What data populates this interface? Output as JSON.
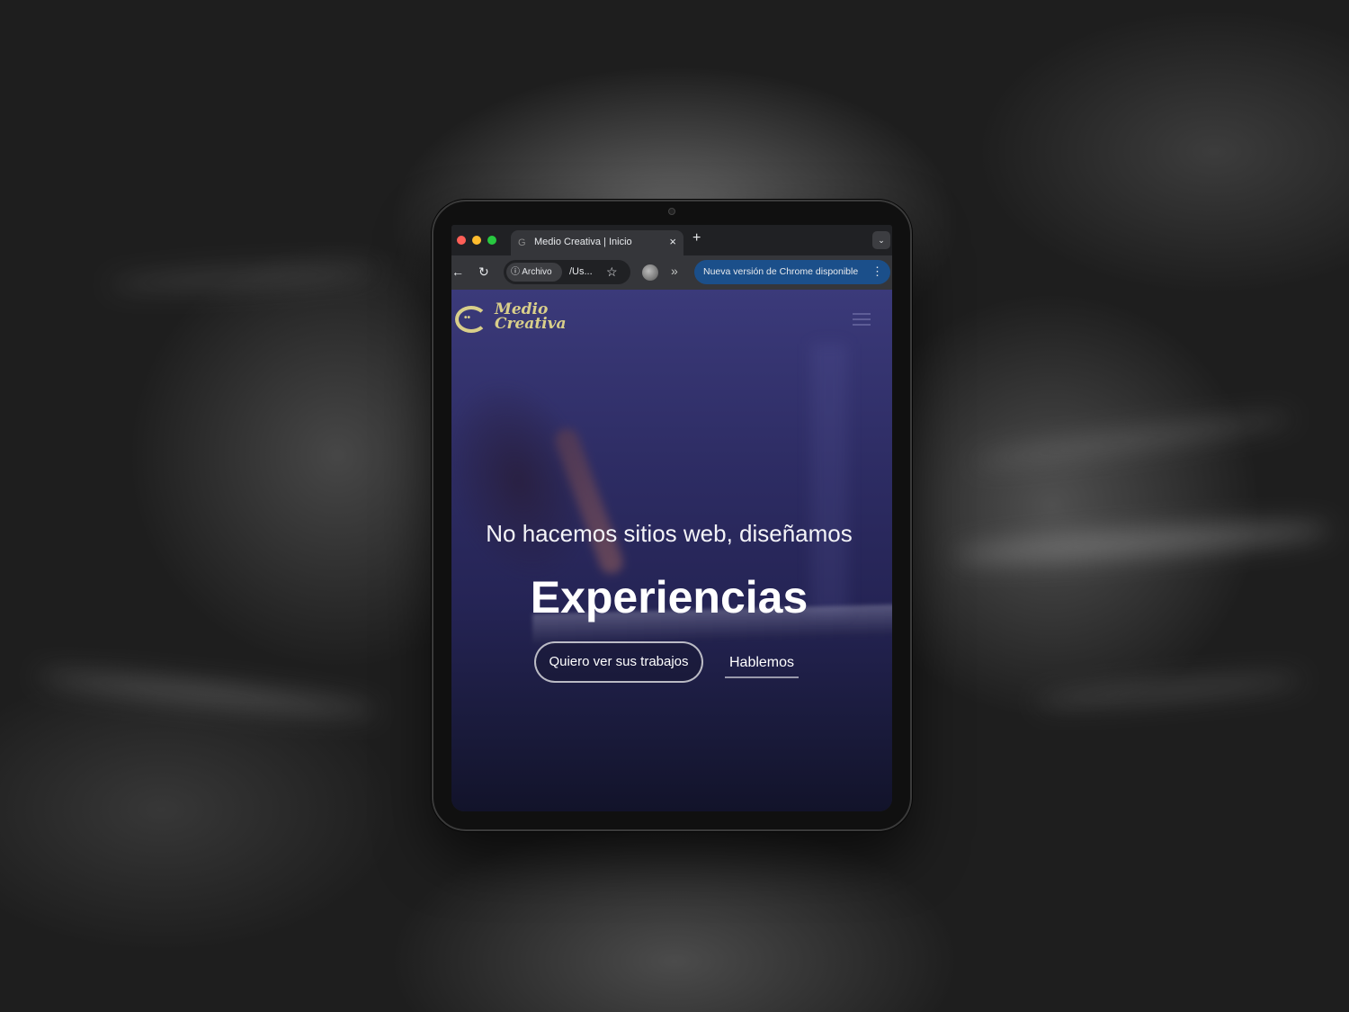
{
  "browser": {
    "tab": {
      "title": "Medio Creativa | Inicio",
      "close": "×"
    },
    "new_tab": "+",
    "tab_menu": "⌄",
    "toolbar": {
      "back": "←",
      "reload": "↻",
      "site_chip": "ⓘ Archivo",
      "url": "/Us...",
      "star": "☆",
      "more_extensions": "»",
      "update_notice": "Nueva versión de Chrome disponible",
      "update_menu": "⋮"
    }
  },
  "site": {
    "logo": {
      "line1": "Medio",
      "line2": "Creativa"
    },
    "hero": {
      "tagline": "No hacemos sitios web, diseñamos",
      "title": "Experiencias",
      "primary_button": "Quiero ver sus trabajos",
      "secondary_button": "Hablemos"
    }
  },
  "colors": {
    "brand_logo": "#d9cf8a",
    "hero_gradient_top": "#3b3a7a",
    "hero_gradient_bottom": "#12132a",
    "chrome_update_pill": "#1b4f8a"
  }
}
